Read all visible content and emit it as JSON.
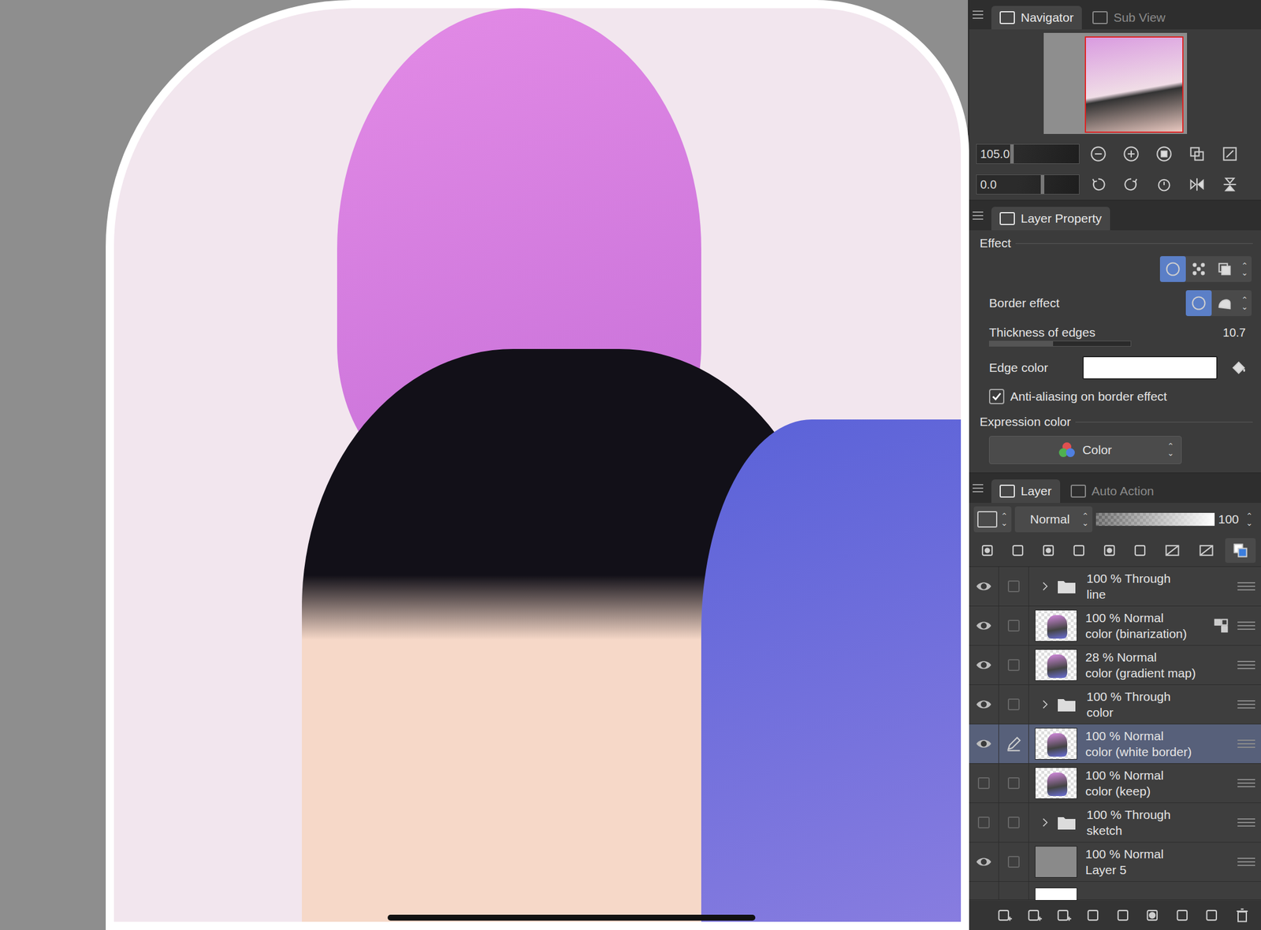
{
  "navigator": {
    "tabs": [
      {
        "label": "Navigator",
        "selected": true
      },
      {
        "label": "Sub View",
        "selected": false
      }
    ],
    "zoom": {
      "value": "105.0",
      "level": 0.2
    },
    "rotation": {
      "value": "0.0",
      "level": 0.5
    }
  },
  "layer_property": {
    "title": "Layer Property",
    "section": "Effect",
    "effects": [
      {
        "selected": true
      },
      {
        "selected": false
      },
      {
        "selected": false
      }
    ],
    "border_effect": {
      "label": "Border effect",
      "styles": [
        {
          "selected": true
        },
        {
          "selected": false
        }
      ]
    },
    "thickness": {
      "label": "Thickness of edges",
      "value": "10.7",
      "level": 0.45
    },
    "edge_color": {
      "label": "Edge color",
      "color": "#ffffff"
    },
    "anti_aliasing": {
      "label": "Anti-aliasing on border effect",
      "checked": true
    },
    "expression_color": {
      "label": "Expression color",
      "value": "Color"
    }
  },
  "layer_panel": {
    "tabs": [
      {
        "label": "Layer",
        "selected": true
      },
      {
        "label": "Auto Action",
        "selected": false
      }
    ],
    "blend_mode": "Normal",
    "opacity": {
      "value": "100",
      "level": 1
    },
    "layers": [
      {
        "kind": "folder",
        "opacity": "100 %",
        "blend": "Through",
        "name": "line",
        "visible": true,
        "selected": false,
        "editing": false,
        "reference": false
      },
      {
        "kind": "raster",
        "opacity": "100 %",
        "blend": "Normal",
        "name": "color (binarization)",
        "visible": true,
        "selected": false,
        "editing": false,
        "reference": true
      },
      {
        "kind": "raster",
        "opacity": "28 %",
        "blend": "Normal",
        "name": "color (gradient map)",
        "visible": true,
        "selected": false,
        "editing": false,
        "reference": false
      },
      {
        "kind": "folder",
        "opacity": "100 %",
        "blend": "Through",
        "name": "color",
        "visible": true,
        "selected": false,
        "editing": false,
        "reference": false
      },
      {
        "kind": "raster",
        "opacity": "100 %",
        "blend": "Normal",
        "name": "color (white border)",
        "visible": true,
        "selected": true,
        "editing": true,
        "reference": false
      },
      {
        "kind": "raster",
        "opacity": "100 %",
        "blend": "Normal",
        "name": "color (keep)",
        "visible": false,
        "selected": false,
        "editing": false,
        "reference": false
      },
      {
        "kind": "folder",
        "opacity": "100 %",
        "blend": "Through",
        "name": "sketch",
        "visible": false,
        "selected": false,
        "editing": false,
        "reference": false
      },
      {
        "kind": "fill",
        "opacity": "100 %",
        "blend": "Normal",
        "name": "Layer 5",
        "visible": true,
        "selected": false,
        "editing": false,
        "reference": false
      }
    ]
  }
}
